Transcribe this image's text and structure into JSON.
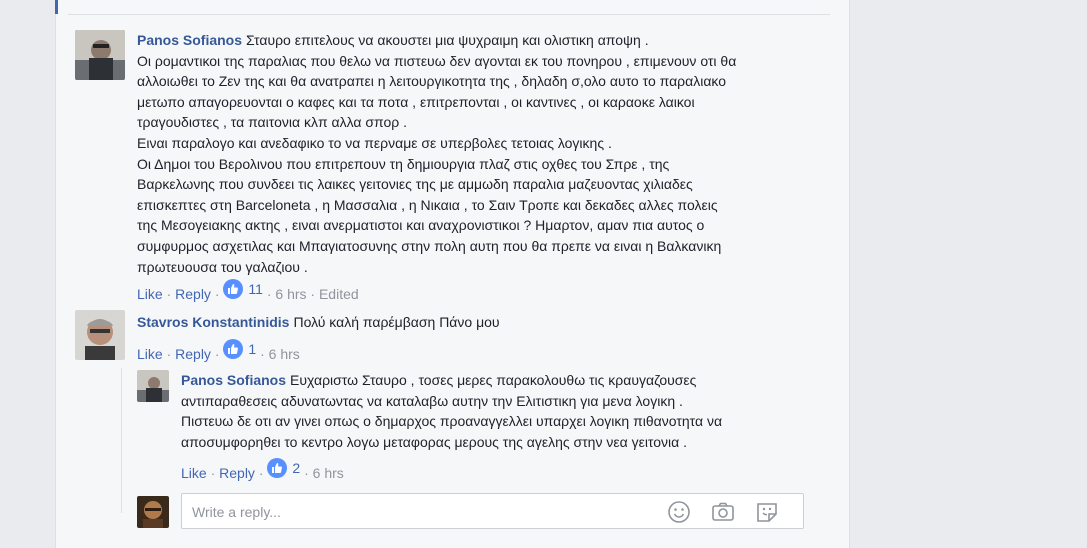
{
  "comments": [
    {
      "author": "Panos Sofianos",
      "text_lines": [
        "Σταυρο επιτελους να ακουστει μια ψυχραιμη και ολιστικη αποψη .",
        "Οι ρομαντικοι της παραλιας που θελω να πιστευω δεν αγονται εκ του πονηρου , επιμενουν οτι θα",
        "αλλοιωθει το Ζεν της και θα ανατραπει η λειτουργικοτητα της , δηλαδη σ,ολο αυτο το παραλιακο",
        "μετωπο απαγορευονται ο καφες και τα ποτα , επιτρεπονται , οι καντινες , οι καραοκε λαικοι",
        "τραγουδιστες , τα παιτονια κλπ αλλα σπορ .",
        "Ειναι παραλογο και ανεδαφικο το να περναμε σε υπερβολες τετοιας λογικης .",
        "Οι Δημοι του Βερολινου που επιτρεπουν τη δημιουργια πλαζ στις οχθες του Σπρε , της",
        "Βαρκελωνης που συνδεει τις λαικες γειτονιες της με αμμωδη παραλια μαζευοντας χιλιαδες",
        "επισκεπτες στη Barceloneta , η Μασσαλια , η Νικαια , το Σαιν Τροπε και δεκαδες αλλες πολεις",
        "της Μεσογειακης ακτης , ειναι ανερματιστοι και αναχρονιστικοι ? Ημαρτον, αμαν πια αυτος ο",
        "συμφυρμος ασχετιλας και Μπαγιατοσυνης στην πολη αυτη που θα πρεπε να ειναι η Βαλκανικη",
        "πρωτευουσα του γαλαζιου ."
      ],
      "like_label": "Like",
      "reply_label": "Reply",
      "likes": "11",
      "time": "6 hrs",
      "edited": "Edited"
    },
    {
      "author": "Stavros Konstantinidis",
      "text_lines": [
        "Πολύ καλή παρέμβαση Πάνο μου"
      ],
      "like_label": "Like",
      "reply_label": "Reply",
      "likes": "1",
      "time": "6 hrs"
    },
    {
      "author": "Panos Sofianos",
      "text_lines": [
        "Ευχαριστω Σταυρο , τοσες μερες παρακολουθω τις κραυγαζουσες",
        "αντιπαραθεσεις αδυνατωντας να καταλαβω αυτην την Ελιτιστικη για μενα λογικη .",
        "Πιστευω δε οτι αν γινει οπως ο δημαρχος προαναγγελλει υπαρχει λογικη πιθανοτητα να",
        "αποσυμφορηθει το κεντρο λογω μεταφορας μερους της αγελης στην νεα γειτονια ."
      ],
      "like_label": "Like",
      "reply_label": "Reply",
      "likes": "2",
      "time": "6 hrs"
    }
  ],
  "reply_box": {
    "placeholder": "Write a reply...",
    "icons": [
      "smiley-icon",
      "camera-icon",
      "sticker-icon"
    ]
  },
  "colors": {
    "author": "#365899",
    "link": "#4267b2",
    "like_badge": "#5890ff",
    "muted": "#90949c"
  }
}
